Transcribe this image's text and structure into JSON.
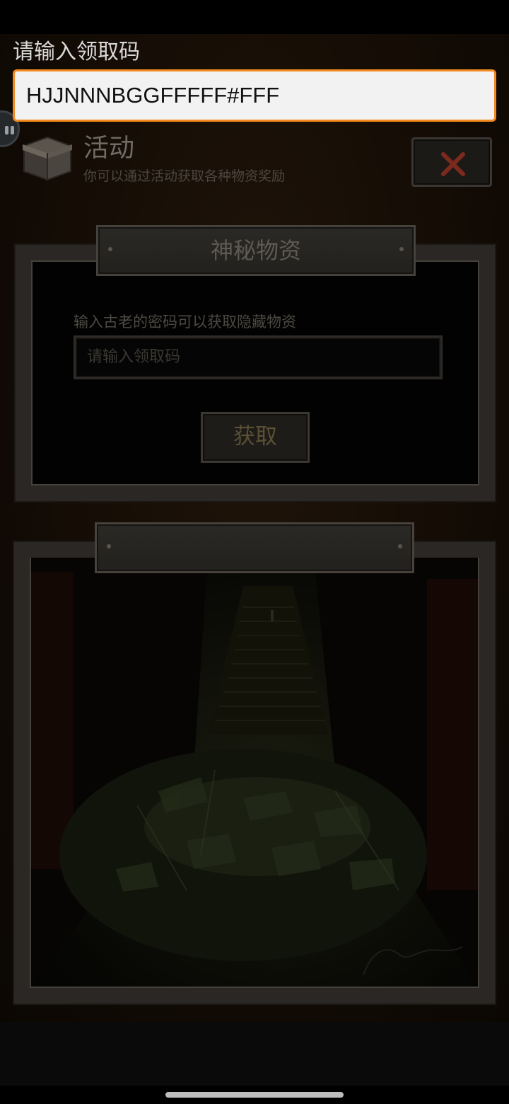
{
  "ime_prompt": {
    "label": "请输入领取码",
    "value": "HJJNNNBGGFFFFF#FFF"
  },
  "header": {
    "title": "活动",
    "subtitle": "你可以通过活动获取各种物资奖励"
  },
  "mystery_panel": {
    "title": "神秘物资",
    "hint": "输入古老的密码可以获取隐藏物资",
    "code_placeholder": "请输入领取码",
    "get_label": "获取"
  },
  "colors": {
    "accent": "#f58a1f",
    "close_x": "#8a2a1c"
  },
  "icons": {
    "close": "close-icon",
    "box": "box-icon",
    "handle": "floating-handle-icon"
  }
}
